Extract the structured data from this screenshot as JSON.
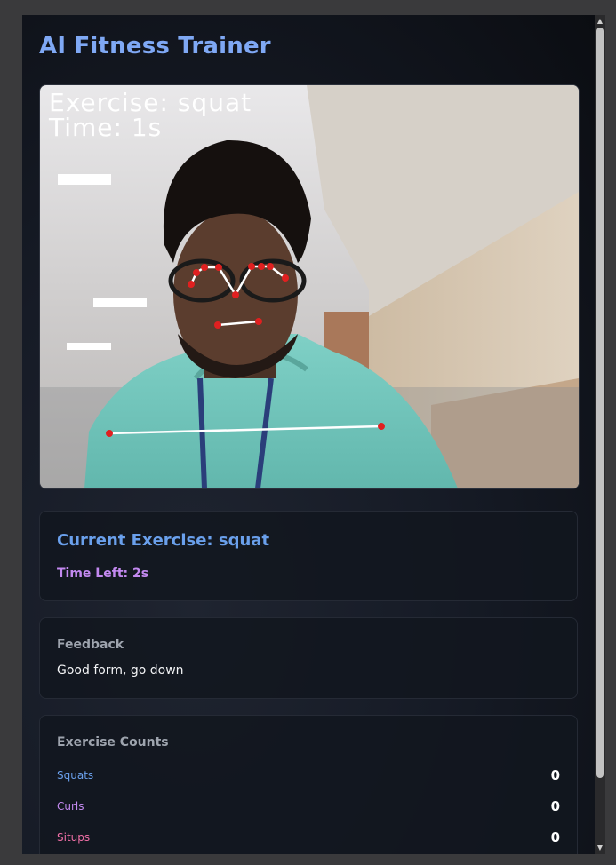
{
  "app": {
    "title": "AI Fitness Trainer"
  },
  "video": {
    "overlay_exercise": "Exercise: squat",
    "overlay_time": "Time: 1s"
  },
  "current": {
    "title": "Current Exercise: squat",
    "time_left": "Time Left: 2s"
  },
  "feedback": {
    "heading": "Feedback",
    "text": "Good form, go down"
  },
  "counts": {
    "heading": "Exercise Counts",
    "items": [
      {
        "label": "Squats",
        "value": "0"
      },
      {
        "label": "Curls",
        "value": "0"
      },
      {
        "label": "Situps",
        "value": "0"
      }
    ]
  },
  "colors": {
    "title": "#7fa8f4",
    "squats": "#6aa0ec",
    "curls": "#c389f0",
    "situps": "#ef6fa6",
    "keypoint": "#e02020"
  },
  "icons": {
    "scroll_up": "chevron-up-icon",
    "scroll_down": "chevron-down-icon"
  }
}
